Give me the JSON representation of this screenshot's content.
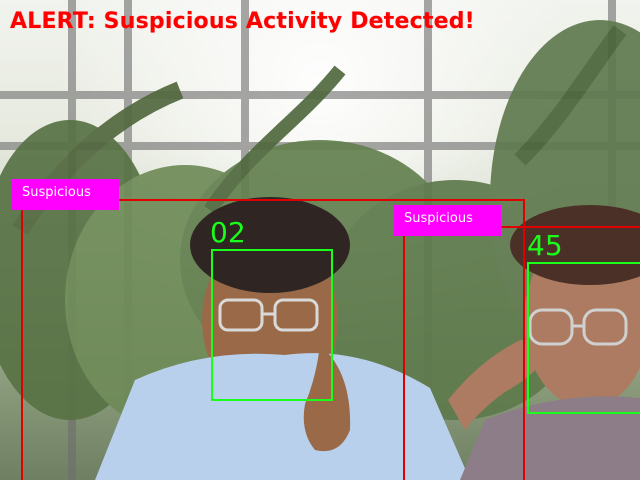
{
  "alert": {
    "text": "ALERT: Suspicious Activity Detected!"
  },
  "detections": [
    {
      "label": "Suspicious",
      "face_id": "02"
    },
    {
      "label": "Suspicious",
      "face_id": "45"
    }
  ],
  "colors": {
    "alert_text": "#ff0000",
    "person_box": "#e10000",
    "label_bg": "#ff00ff",
    "face_box": "#19ff19"
  }
}
